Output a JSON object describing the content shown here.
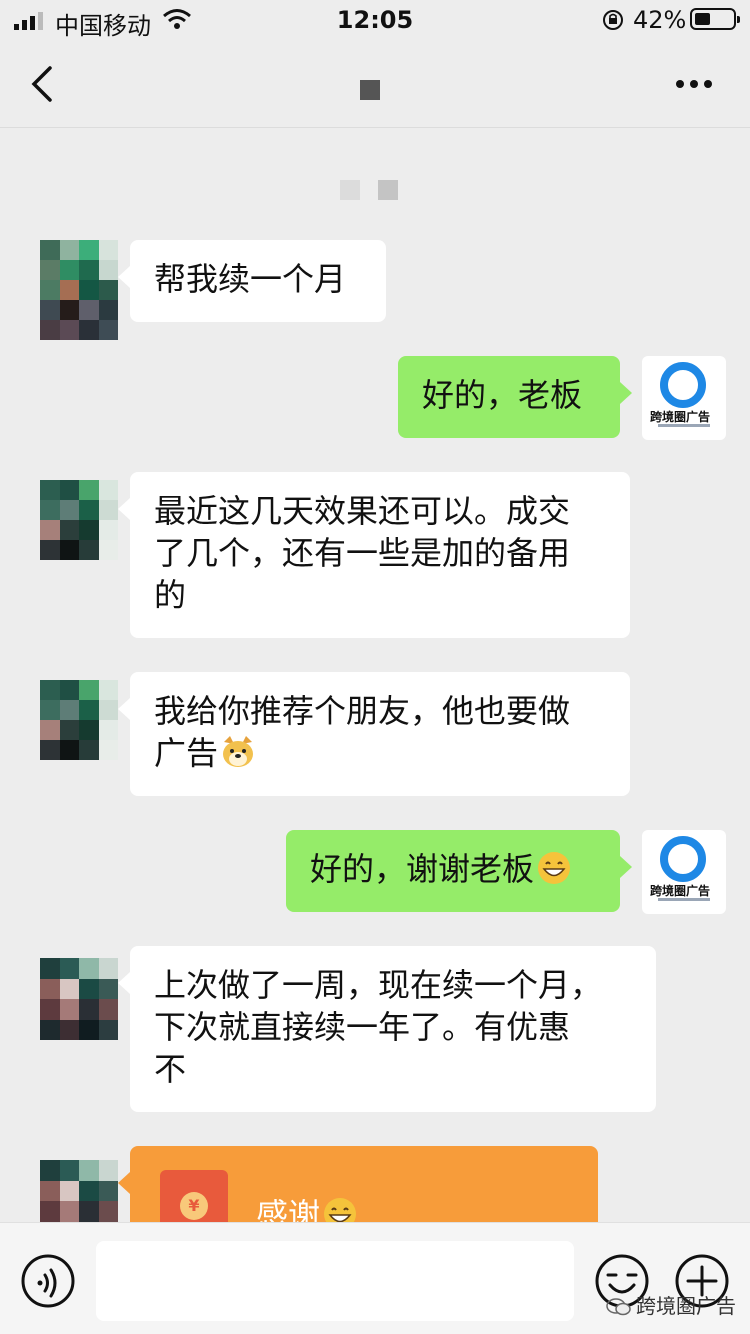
{
  "status_bar": {
    "carrier": "中国移动",
    "time": "12:05",
    "battery_percent": "42%",
    "battery_level": 0.42
  },
  "nav": {
    "back_icon": "chevron-left-icon",
    "more_icon": "ellipsis-icon"
  },
  "messages": [
    {
      "side": "in",
      "text": "帮我续一个月"
    },
    {
      "side": "out",
      "text": "好的，老板"
    },
    {
      "side": "in",
      "lines": [
        "最近这几天效果还可以。成交",
        "了几个，还有一些是加的备用",
        "的"
      ]
    },
    {
      "side": "in",
      "lines": [
        "我给你推荐个朋友，他也要做",
        "广告"
      ],
      "emoji": "doge-emoji"
    },
    {
      "side": "out",
      "text": "好的，谢谢老板",
      "emoji": "grin-emoji"
    },
    {
      "side": "in",
      "lines": [
        "上次做了一周，现在续一个月，",
        "下次就直接续一年了。有优惠",
        "不"
      ]
    }
  ],
  "brand_avatar": {
    "text": "跨境圈广告"
  },
  "red_packet": {
    "label": "感谢",
    "coin": "¥",
    "emoji": "grin-emoji"
  },
  "input_bar": {
    "placeholder": ""
  },
  "watermark": {
    "text": "跨境圈广告"
  },
  "colors": {
    "background": "#ededed",
    "outgoing_bubble": "#95ec69",
    "incoming_bubble": "#ffffff",
    "red_packet": "#f79c3a",
    "brand_blue": "#1e88e5"
  }
}
